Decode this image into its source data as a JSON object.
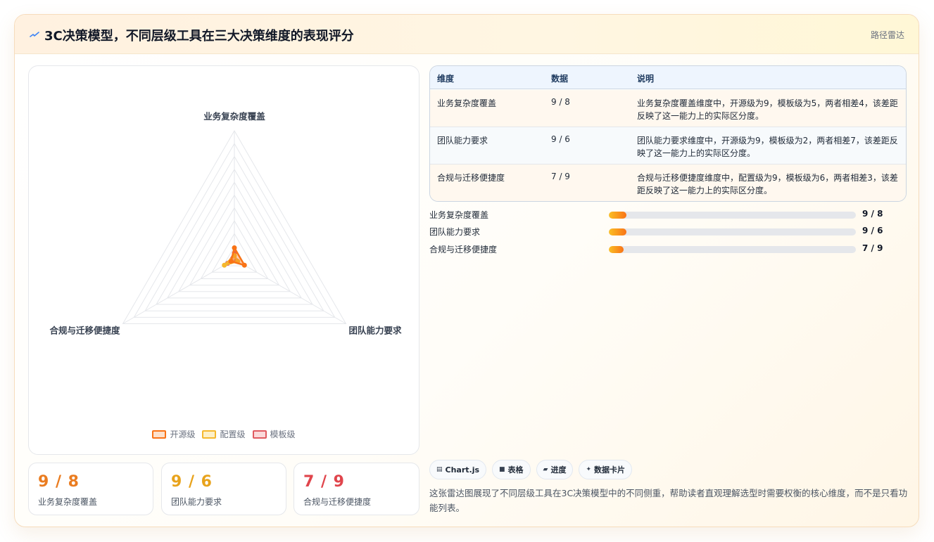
{
  "header": {
    "title": "3C决策模型，不同层级工具在三大决策维度的表现评分",
    "badge": "路径雷达",
    "icon": "spark-icon"
  },
  "chart_data": {
    "type": "radar",
    "axes": [
      "业务复杂度覆盖",
      "团队能力要求",
      "合规与迁移便捷度"
    ],
    "rmax": 100,
    "rings": 10,
    "series": [
      {
        "name": "开源级",
        "values": [
          9,
          9,
          3
        ],
        "color": "#f97316"
      },
      {
        "name": "配置级",
        "values": [
          3,
          3,
          9
        ],
        "color": "#f5b82e"
      },
      {
        "name": "模板级",
        "values": [
          5,
          2,
          6
        ],
        "color": "#e05a60"
      }
    ],
    "legend_position": "bottom"
  },
  "legend": [
    {
      "label": "开源级",
      "color": "#f97316",
      "fill": "#fde1cc"
    },
    {
      "label": "配置级",
      "color": "#f5b82e",
      "fill": "#fdf0c8"
    },
    {
      "label": "模板级",
      "color": "#e05a60",
      "fill": "#fbd9da"
    }
  ],
  "stats": [
    {
      "value": "9 / 8",
      "label": "业务复杂度覆盖",
      "color": "#ea7c20"
    },
    {
      "value": "9 / 6",
      "label": "团队能力要求",
      "color": "#e8a31c"
    },
    {
      "value": "7 / 9",
      "label": "合规与迁移便捷度",
      "color": "#e0454c"
    }
  ],
  "table": {
    "headers": [
      "维度",
      "数据",
      "说明"
    ],
    "rows": [
      {
        "dim": "业务复杂度覆盖",
        "data": "9 / 8",
        "desc": "业务复杂度覆盖维度中，开源级为9，模板级为5，两者相差4，该差距反映了这一能力上的实际区分度。"
      },
      {
        "dim": "团队能力要求",
        "data": "9 / 6",
        "desc": "团队能力要求维度中，开源级为9，模板级为2，两者相差7，该差距反映了这一能力上的实际区分度。"
      },
      {
        "dim": "合规与迁移便捷度",
        "data": "7 / 9",
        "desc": "合规与迁移便捷度维度中，配置级为9，模板级为6，两者相差3，该差距反映了这一能力上的实际区分度。"
      }
    ]
  },
  "bars": [
    {
      "label": "业务复杂度覆盖",
      "value": "9 / 8",
      "fraction": 0.07
    },
    {
      "label": "团队能力要求",
      "value": "9 / 6",
      "fraction": 0.07
    },
    {
      "label": "合规与迁移便捷度",
      "value": "7 / 9",
      "fraction": 0.06
    }
  ],
  "chips": [
    {
      "icon": "▤",
      "label": "Chart.js"
    },
    {
      "icon": "■",
      "label": "表格"
    },
    {
      "icon": "▰",
      "label": "进度"
    },
    {
      "icon": "✦",
      "label": "数据卡片"
    }
  ],
  "footnote": "这张雷达图展现了不同层级工具在3C决策模型中的不同侧重，帮助读者直观理解选型时需要权衡的核心维度，而不是只看功能列表。"
}
